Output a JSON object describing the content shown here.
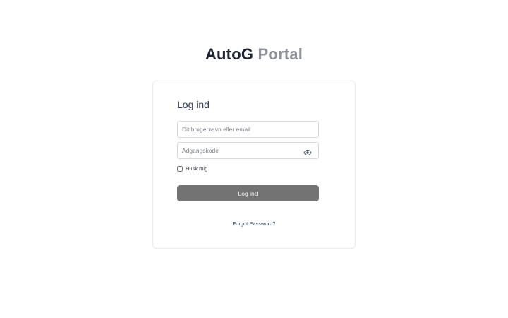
{
  "header": {
    "brand_primary": "AutoG",
    "brand_secondary": "Portal"
  },
  "login_card": {
    "title": "Log ind",
    "username": {
      "placeholder": "Dit brugernavn eller email",
      "value": ""
    },
    "password": {
      "placeholder": "Adgangskode",
      "value": "",
      "toggle_icon": "eye-icon"
    },
    "remember_me": {
      "label": "Husk mig",
      "checked": false
    },
    "submit_label": "Log ind",
    "forgot_password_label": "Forgot Password?"
  },
  "colors": {
    "brand_primary": "#1e2430",
    "brand_secondary": "#8e929b",
    "title": "#2b3a55",
    "button_bg": "#737373",
    "button_text": "#f2f2f2",
    "border": "#d7dade"
  }
}
